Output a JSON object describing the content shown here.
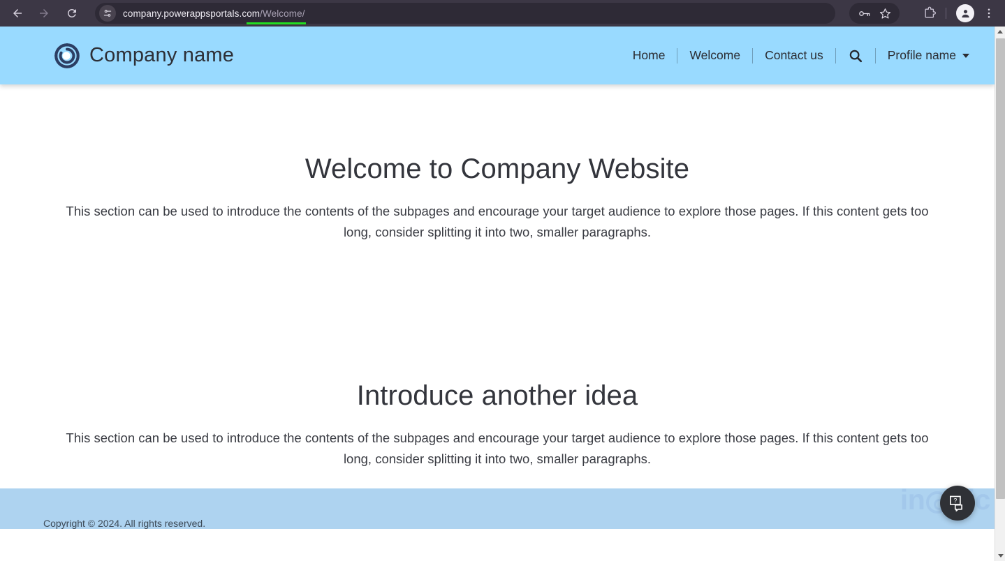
{
  "browser": {
    "back_icon": "back-arrow-icon",
    "forward_icon": "forward-arrow-icon",
    "reload_icon": "reload-icon",
    "site_info_icon": "site-settings-icon",
    "url_host": "company.powerappsportals.com",
    "url_path": "/Welcome/",
    "password_icon": "password-key-icon",
    "bookmark_icon": "bookmark-star-icon",
    "extensions_icon": "extensions-puzzle-icon",
    "profile_icon": "profile-avatar-icon",
    "menu_icon": "three-dot-menu-icon",
    "highlight_color": "#22dd22"
  },
  "site": {
    "brand_name": "Company name",
    "logo_icon": "company-spiral-logo",
    "header_color": "#99daff",
    "footer_color": "#aed3f0",
    "nav": {
      "home": "Home",
      "welcome": "Welcome",
      "contact": "Contact us",
      "search_icon": "search-icon",
      "profile": "Profile name",
      "caret_icon": "chevron-down-icon"
    }
  },
  "main": {
    "sections": [
      {
        "title": "Welcome to Company Website",
        "body": "This section can be used to introduce the contents of the subpages and encourage your target audience to explore those pages. If this content gets too long, consider splitting it into two, smaller paragraphs."
      },
      {
        "title": "Introduce another idea",
        "body": "This section can be used to introduce the contents of the subpages and encourage your target audience to explore those pages. If this content gets too long, consider splitting it into two, smaller paragraphs."
      }
    ]
  },
  "footer": {
    "copyright": "Copyright © 2024. All rights reserved."
  },
  "watermark": {
    "part_1": "in",
    "part_2": "gic"
  },
  "chat": {
    "icon": "chat-help-bubble-icon"
  },
  "scrollbar": {
    "up_icon": "scroll-up-arrow",
    "down_icon": "scroll-down-arrow"
  }
}
